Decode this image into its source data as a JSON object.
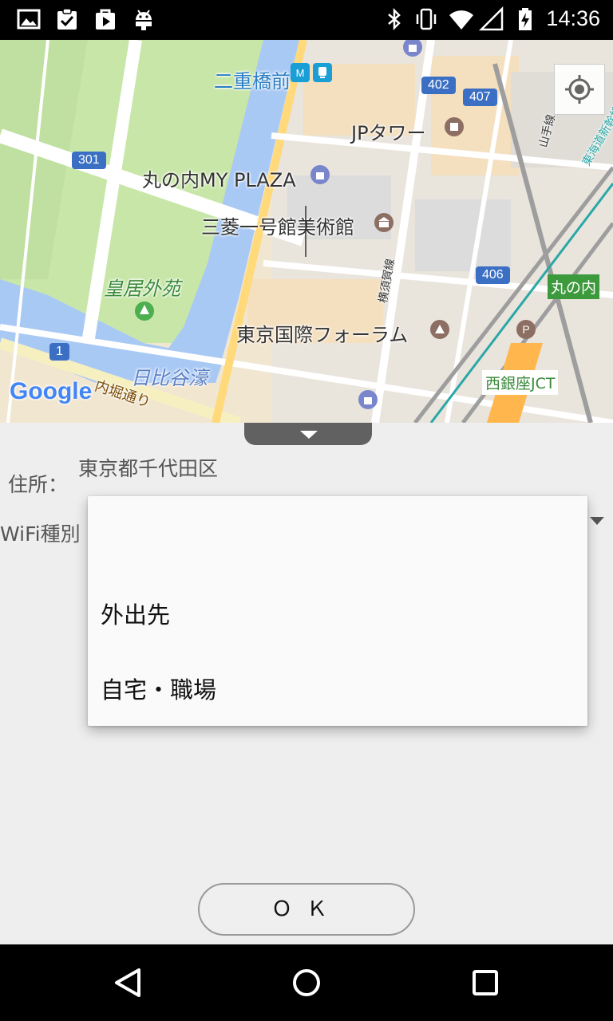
{
  "status_bar": {
    "time": "14:36",
    "left_icons": [
      "image-icon",
      "clipboard-check-icon",
      "video-bag-icon",
      "android-icon"
    ],
    "right_icons": [
      "bluetooth-icon",
      "vibrate-icon",
      "wifi-icon",
      "signal-icon",
      "battery-icon"
    ]
  },
  "map": {
    "labels": {
      "nijubashimae": "二重橋前",
      "jp_tower": "JPタワー",
      "marunouchi_my_plaza": "丸の内MY PLAZA",
      "mitsubishi_museum": "三菱一号館美術館",
      "kokyo_gaien": "皇居外苑",
      "tokyo_forum": "東京国際フォーラム",
      "hibiya_moat": "日比谷濠",
      "uchibori_dori": "内堀通り",
      "nishiginza_jct": "西銀座JCT",
      "marunouchi_badge": "丸の内",
      "yamanote_line": "山手線",
      "yokosuka_line": "横須賀線",
      "tokaido_shinkansen": "東海道新幹線",
      "google_logo": "Google"
    },
    "road_numbers": {
      "r301": "301",
      "r402": "402",
      "r407": "407",
      "r406": "406",
      "r1": "1"
    }
  },
  "form": {
    "address_label": "住所：",
    "address_value": "東京都千代田区",
    "wifi_type_label": "WiFi種別"
  },
  "dropdown": {
    "options": [
      "",
      "外出先",
      "自宅・職場"
    ]
  },
  "ok_button": {
    "label": "ＯＫ"
  },
  "nav_bar": {
    "icons": [
      "back-icon",
      "home-icon",
      "recents-icon"
    ]
  },
  "colors": {
    "park_green": "#c8e6a8",
    "water_blue": "#a9c9f5",
    "road_badge": "#3a6fc4",
    "station_badge": "#3c9a3c"
  }
}
